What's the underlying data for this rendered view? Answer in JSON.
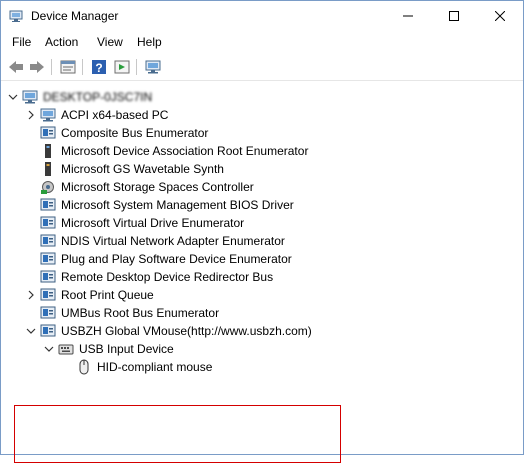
{
  "window": {
    "title": "Device Manager"
  },
  "menu": {
    "file": "File",
    "action": "Action",
    "view": "View",
    "help": "Help"
  },
  "toolbar": {
    "buttons": [
      "back-icon",
      "forward-icon",
      "properties-icon",
      "help-icon",
      "update-driver-icon",
      "scan-hardware-icon"
    ]
  },
  "tree": {
    "root": "DESKTOP-0JSC7IN",
    "items": [
      {
        "label": "ACPI x64-based PC",
        "expander": "collapsed",
        "icon": "computer-icon"
      },
      {
        "label": "Composite Bus Enumerator",
        "expander": "none",
        "icon": "system-device-icon"
      },
      {
        "label": "Microsoft Device Association Root Enumerator",
        "expander": "none",
        "icon": "device-association-icon"
      },
      {
        "label": "Microsoft GS Wavetable Synth",
        "expander": "none",
        "icon": "wavetable-icon"
      },
      {
        "label": "Microsoft Storage Spaces Controller",
        "expander": "none",
        "icon": "storage-controller-icon"
      },
      {
        "label": "Microsoft System Management BIOS Driver",
        "expander": "none",
        "icon": "system-device-icon"
      },
      {
        "label": "Microsoft Virtual Drive Enumerator",
        "expander": "none",
        "icon": "system-device-icon"
      },
      {
        "label": "NDIS Virtual Network Adapter Enumerator",
        "expander": "none",
        "icon": "system-device-icon"
      },
      {
        "label": "Plug and Play Software Device Enumerator",
        "expander": "none",
        "icon": "system-device-icon"
      },
      {
        "label": "Remote Desktop Device Redirector Bus",
        "expander": "none",
        "icon": "system-device-icon"
      },
      {
        "label": "Root Print Queue",
        "expander": "collapsed",
        "icon": "system-device-icon"
      },
      {
        "label": "UMBus Root Bus Enumerator",
        "expander": "none",
        "icon": "system-device-icon"
      },
      {
        "label": "USBZH Global VMouse(http://www.usbzh.com)",
        "expander": "expanded",
        "icon": "system-device-icon"
      },
      {
        "label": "USB Input Device",
        "expander": "expanded",
        "icon": "hid-keyboard-icon"
      },
      {
        "label": "HID-compliant mouse",
        "expander": "none",
        "icon": "mouse-icon"
      }
    ]
  },
  "colors": {
    "highlight_border": "#d40000",
    "accent": "#1a6fc4"
  }
}
